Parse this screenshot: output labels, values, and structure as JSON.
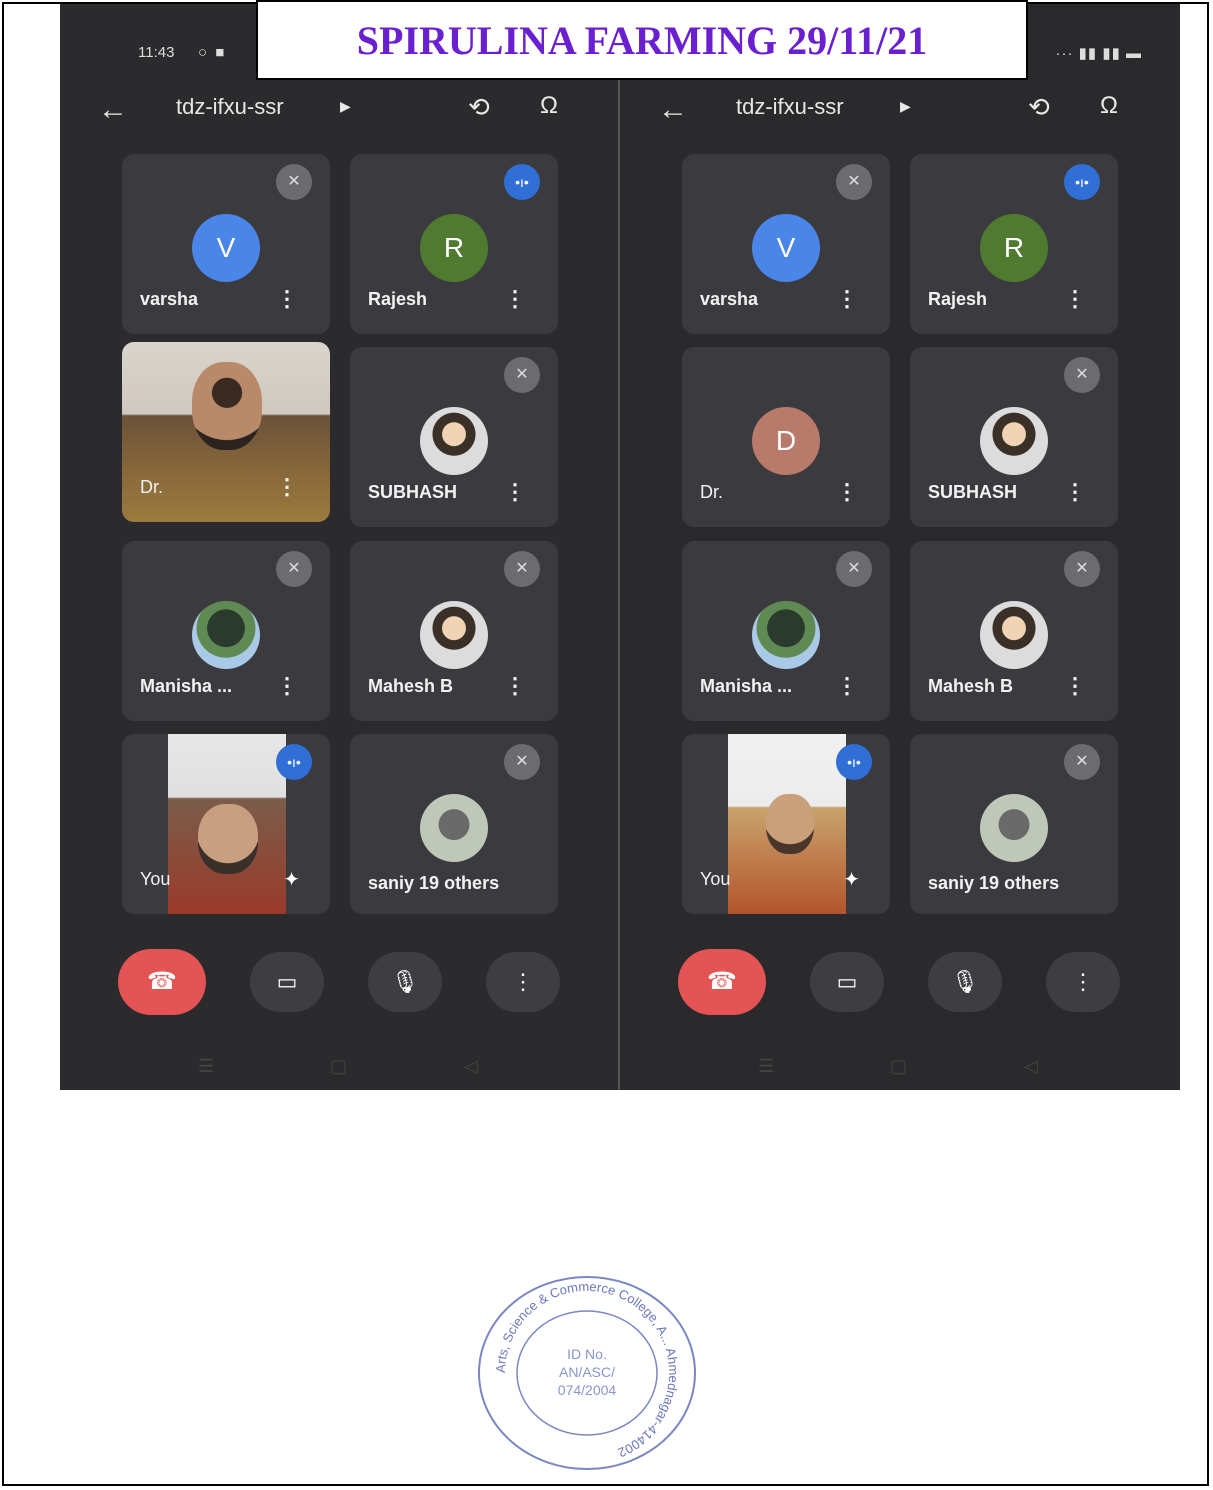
{
  "doc": {
    "title": "SPIRULINA FARMING 29/11/21"
  },
  "status": {
    "time": "11:43",
    "left_icons": "○ ■",
    "right_icons": "··· ▮▮ ▮▮ ▬"
  },
  "meeting": {
    "code": "tdz-ifxu-ssr"
  },
  "screens": [
    {
      "tiles": [
        {
          "name": "varsha",
          "avatar_letter": "V",
          "avatar_color": "#4a86e8",
          "mic": "muted"
        },
        {
          "name": "Rajesh",
          "avatar_letter": "R",
          "avatar_color": "#4f7a2f",
          "mic": "speaking"
        },
        {
          "name": "Dr.",
          "video": true,
          "mic": "none"
        },
        {
          "name": "SUBHASH",
          "mic": "muted"
        },
        {
          "name": "Manisha ...",
          "mic": "muted"
        },
        {
          "name": "Mahesh B",
          "mic": "muted"
        },
        {
          "name": "You",
          "self_view": true,
          "mic": "speaking"
        },
        {
          "name": "saniy",
          "others_label": "19 others",
          "mic": "muted"
        }
      ]
    },
    {
      "tiles": [
        {
          "name": "varsha",
          "avatar_letter": "V",
          "avatar_color": "#4a86e8",
          "mic": "muted"
        },
        {
          "name": "Rajesh",
          "avatar_letter": "R",
          "avatar_color": "#4f7a2f",
          "mic": "speaking"
        },
        {
          "name": "Dr.",
          "avatar_letter": "D",
          "avatar_color": "#b77a6b",
          "mic": "none"
        },
        {
          "name": "SUBHASH",
          "mic": "muted"
        },
        {
          "name": "Manisha ...",
          "mic": "muted"
        },
        {
          "name": "Mahesh B",
          "mic": "muted"
        },
        {
          "name": "You",
          "self_view": true,
          "mic": "speaking"
        },
        {
          "name": "saniy",
          "others_label": "19 others",
          "mic": "muted"
        }
      ]
    }
  ],
  "stamp": {
    "ring_text": "Arts, Science & Commerce College, A... Ahmednagar-414002",
    "id_label": "ID No.",
    "id_line1": "AN/ASC/",
    "id_line2": "074/2004"
  }
}
